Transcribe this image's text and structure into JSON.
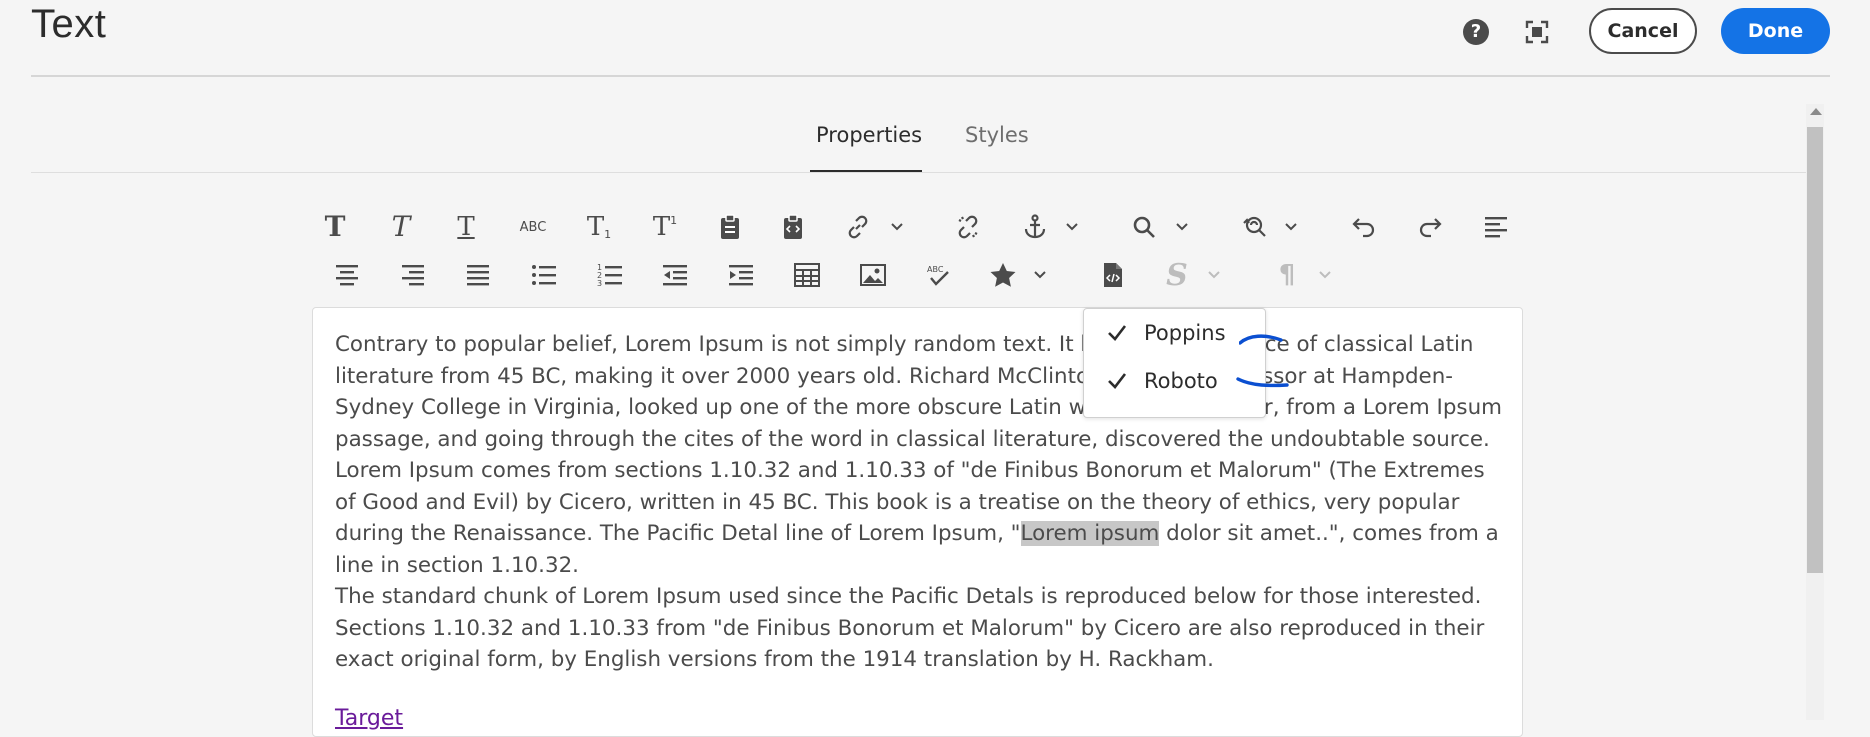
{
  "header": {
    "title": "Text",
    "help_glyph": "?",
    "cancel_label": "Cancel",
    "done_label": "Done"
  },
  "tabs": [
    {
      "label": "Properties",
      "active": true
    },
    {
      "label": "Styles",
      "active": false
    }
  ],
  "toolbar": {
    "row1": [
      "bold-icon",
      "italic-icon",
      "underline-icon",
      "strikethrough-icon",
      "subscript-icon",
      "superscript-icon",
      "paste-icon",
      "paste-html-icon",
      "link-icon",
      "unlink-icon",
      "anchor-icon",
      "find-icon",
      "find-replace-icon",
      "undo-icon",
      "redo-icon",
      "align-left-icon"
    ],
    "row2": [
      "align-center-icon",
      "align-right-icon",
      "justify-icon",
      "bullet-list-icon",
      "numbered-list-icon",
      "outdent-icon",
      "indent-icon",
      "table-icon",
      "image-icon",
      "spellcheck-icon",
      "star-icon",
      "source-edit-icon",
      "styles-icon",
      "paragraph-icon"
    ],
    "abc_label": "ABC",
    "t_glyph": "T",
    "sub_glyph": "1",
    "sup_glyph": "1",
    "styles_glyph": "S",
    "paragraph_glyph": "¶"
  },
  "font_dropdown": {
    "options": [
      {
        "label": "Poppins",
        "checked": true
      },
      {
        "label": "Roboto",
        "checked": true
      }
    ]
  },
  "editor": {
    "para1_before": "Contrary to popular belief, Lorem Ipsum is not simply random text. It has roots in a piece of classical Latin literature from 45 BC, making it over 2000 years old. Richard McClintock, a Latin professor at Hampden-Sydney College in Virginia, looked up one of the more obscure Latin words, consectetur, from a Lorem Ipsum passage, and going through the cites of the word in classical literature, discovered the undoubtable source. Lorem Ipsum comes from sections 1.10.32 and 1.10.33 of \"de Finibus Bonorum et Malorum\" (The Extremes of Good and Evil) by Cicero, written in 45 BC. This book is a treatise on the theory of ethics, very popular during the Renaissance. The Pacific Detal line of Lorem Ipsum, \"",
    "para1_highlight": "Lorem ipsum",
    "para1_after": " dolor sit amet..\", comes from a line in section 1.10.32.",
    "para2": "The standard chunk of Lorem Ipsum used since the Pacific Detals is reproduced below for those interested. Sections 1.10.32 and 1.10.33 from \"de Finibus Bonorum et Malorum\" by Cicero are also reproduced in their exact original form, by English versions from the 1914 translation by H. Rackham.",
    "link_text": "Target"
  },
  "colors": {
    "accent": "#1473e6",
    "annotation": "#0b4fd1",
    "link": "#6a1b9a"
  }
}
